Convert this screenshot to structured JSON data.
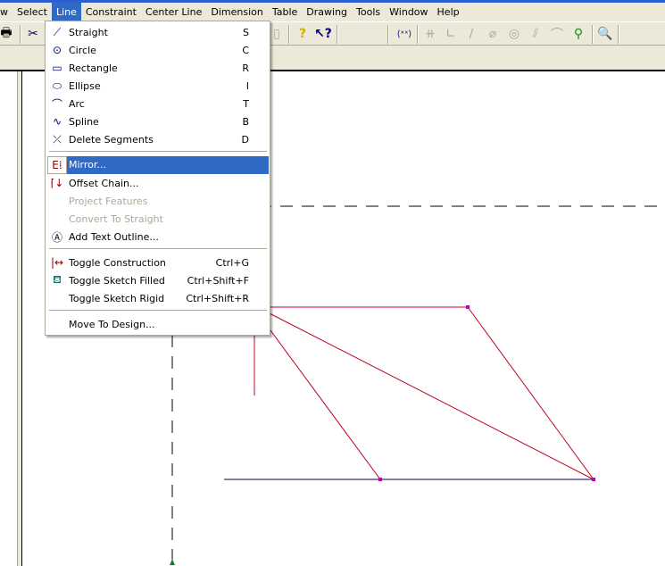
{
  "menubar": [
    "w",
    "Select",
    "Line",
    "Constraint",
    "Center Line",
    "Dimension",
    "Table",
    "Drawing",
    "Tools",
    "Window",
    "Help"
  ],
  "line_menu": [
    {
      "label": "Straight",
      "shortcut": "S",
      "icon": "line-icon"
    },
    {
      "label": "Circle",
      "shortcut": "C",
      "icon": "circle-icon"
    },
    {
      "label": "Rectangle",
      "shortcut": "R",
      "icon": "rectangle-icon"
    },
    {
      "label": "Ellipse",
      "shortcut": "I",
      "icon": "ellipse-icon"
    },
    {
      "label": "Arc",
      "shortcut": "T",
      "icon": "arc-icon"
    },
    {
      "label": "Spline",
      "shortcut": "B",
      "icon": "spline-icon"
    },
    {
      "label": "Delete Segments",
      "shortcut": "D",
      "icon": "delete-segments-icon"
    },
    {
      "label": "Mirror...",
      "shortcut": "",
      "icon": "mirror-icon",
      "highlighted": true
    },
    {
      "label": "Offset Chain...",
      "shortcut": "",
      "icon": "offset-chain-icon"
    },
    {
      "label": "Project Features",
      "shortcut": "",
      "disabled": true
    },
    {
      "label": "Convert To Straight",
      "shortcut": "",
      "disabled": true
    },
    {
      "label": "Add Text Outline...",
      "shortcut": "",
      "icon": "text-outline-icon"
    },
    {
      "label": "Toggle Construction",
      "shortcut": "Ctrl+G",
      "icon": "construction-icon"
    },
    {
      "label": "Toggle Sketch Filled",
      "shortcut": "Ctrl+Shift+F",
      "icon": "fill-bucket-icon"
    },
    {
      "label": "Toggle Sketch Rigid",
      "shortcut": "Ctrl+Shift+R"
    },
    {
      "label": "Move To Design...",
      "shortcut": ""
    }
  ],
  "colors": {
    "highlight": "#316ac5",
    "sketch": "#c00020",
    "menubar_bg": "#ece9d8"
  }
}
